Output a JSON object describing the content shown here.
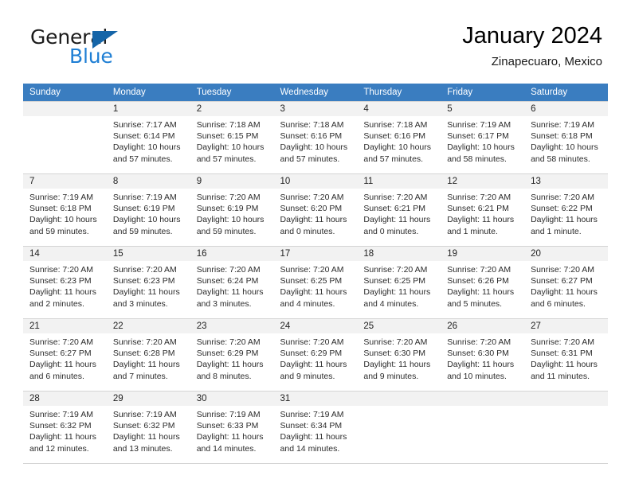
{
  "brand": {
    "name_top": "General",
    "name_bottom": "Blue",
    "triangle_color": "#1565a8",
    "blue_color": "#1f7fd4"
  },
  "header": {
    "title": "January 2024",
    "subtitle": "Zinapecuaro, Mexico",
    "header_bg": "#3a7dc0",
    "shaded_row_bg": "#f2f2f2"
  },
  "weekdays": [
    "Sunday",
    "Monday",
    "Tuesday",
    "Wednesday",
    "Thursday",
    "Friday",
    "Saturday"
  ],
  "weeks": [
    [
      {
        "day": "",
        "sunrise": "",
        "sunset": "",
        "daylight1": "",
        "daylight2": ""
      },
      {
        "day": "1",
        "sunrise": "Sunrise: 7:17 AM",
        "sunset": "Sunset: 6:14 PM",
        "daylight1": "Daylight: 10 hours",
        "daylight2": "and 57 minutes."
      },
      {
        "day": "2",
        "sunrise": "Sunrise: 7:18 AM",
        "sunset": "Sunset: 6:15 PM",
        "daylight1": "Daylight: 10 hours",
        "daylight2": "and 57 minutes."
      },
      {
        "day": "3",
        "sunrise": "Sunrise: 7:18 AM",
        "sunset": "Sunset: 6:16 PM",
        "daylight1": "Daylight: 10 hours",
        "daylight2": "and 57 minutes."
      },
      {
        "day": "4",
        "sunrise": "Sunrise: 7:18 AM",
        "sunset": "Sunset: 6:16 PM",
        "daylight1": "Daylight: 10 hours",
        "daylight2": "and 57 minutes."
      },
      {
        "day": "5",
        "sunrise": "Sunrise: 7:19 AM",
        "sunset": "Sunset: 6:17 PM",
        "daylight1": "Daylight: 10 hours",
        "daylight2": "and 58 minutes."
      },
      {
        "day": "6",
        "sunrise": "Sunrise: 7:19 AM",
        "sunset": "Sunset: 6:18 PM",
        "daylight1": "Daylight: 10 hours",
        "daylight2": "and 58 minutes."
      }
    ],
    [
      {
        "day": "7",
        "sunrise": "Sunrise: 7:19 AM",
        "sunset": "Sunset: 6:18 PM",
        "daylight1": "Daylight: 10 hours",
        "daylight2": "and 59 minutes."
      },
      {
        "day": "8",
        "sunrise": "Sunrise: 7:19 AM",
        "sunset": "Sunset: 6:19 PM",
        "daylight1": "Daylight: 10 hours",
        "daylight2": "and 59 minutes."
      },
      {
        "day": "9",
        "sunrise": "Sunrise: 7:20 AM",
        "sunset": "Sunset: 6:19 PM",
        "daylight1": "Daylight: 10 hours",
        "daylight2": "and 59 minutes."
      },
      {
        "day": "10",
        "sunrise": "Sunrise: 7:20 AM",
        "sunset": "Sunset: 6:20 PM",
        "daylight1": "Daylight: 11 hours",
        "daylight2": "and 0 minutes."
      },
      {
        "day": "11",
        "sunrise": "Sunrise: 7:20 AM",
        "sunset": "Sunset: 6:21 PM",
        "daylight1": "Daylight: 11 hours",
        "daylight2": "and 0 minutes."
      },
      {
        "day": "12",
        "sunrise": "Sunrise: 7:20 AM",
        "sunset": "Sunset: 6:21 PM",
        "daylight1": "Daylight: 11 hours",
        "daylight2": "and 1 minute."
      },
      {
        "day": "13",
        "sunrise": "Sunrise: 7:20 AM",
        "sunset": "Sunset: 6:22 PM",
        "daylight1": "Daylight: 11 hours",
        "daylight2": "and 1 minute."
      }
    ],
    [
      {
        "day": "14",
        "sunrise": "Sunrise: 7:20 AM",
        "sunset": "Sunset: 6:23 PM",
        "daylight1": "Daylight: 11 hours",
        "daylight2": "and 2 minutes."
      },
      {
        "day": "15",
        "sunrise": "Sunrise: 7:20 AM",
        "sunset": "Sunset: 6:23 PM",
        "daylight1": "Daylight: 11 hours",
        "daylight2": "and 3 minutes."
      },
      {
        "day": "16",
        "sunrise": "Sunrise: 7:20 AM",
        "sunset": "Sunset: 6:24 PM",
        "daylight1": "Daylight: 11 hours",
        "daylight2": "and 3 minutes."
      },
      {
        "day": "17",
        "sunrise": "Sunrise: 7:20 AM",
        "sunset": "Sunset: 6:25 PM",
        "daylight1": "Daylight: 11 hours",
        "daylight2": "and 4 minutes."
      },
      {
        "day": "18",
        "sunrise": "Sunrise: 7:20 AM",
        "sunset": "Sunset: 6:25 PM",
        "daylight1": "Daylight: 11 hours",
        "daylight2": "and 4 minutes."
      },
      {
        "day": "19",
        "sunrise": "Sunrise: 7:20 AM",
        "sunset": "Sunset: 6:26 PM",
        "daylight1": "Daylight: 11 hours",
        "daylight2": "and 5 minutes."
      },
      {
        "day": "20",
        "sunrise": "Sunrise: 7:20 AM",
        "sunset": "Sunset: 6:27 PM",
        "daylight1": "Daylight: 11 hours",
        "daylight2": "and 6 minutes."
      }
    ],
    [
      {
        "day": "21",
        "sunrise": "Sunrise: 7:20 AM",
        "sunset": "Sunset: 6:27 PM",
        "daylight1": "Daylight: 11 hours",
        "daylight2": "and 6 minutes."
      },
      {
        "day": "22",
        "sunrise": "Sunrise: 7:20 AM",
        "sunset": "Sunset: 6:28 PM",
        "daylight1": "Daylight: 11 hours",
        "daylight2": "and 7 minutes."
      },
      {
        "day": "23",
        "sunrise": "Sunrise: 7:20 AM",
        "sunset": "Sunset: 6:29 PM",
        "daylight1": "Daylight: 11 hours",
        "daylight2": "and 8 minutes."
      },
      {
        "day": "24",
        "sunrise": "Sunrise: 7:20 AM",
        "sunset": "Sunset: 6:29 PM",
        "daylight1": "Daylight: 11 hours",
        "daylight2": "and 9 minutes."
      },
      {
        "day": "25",
        "sunrise": "Sunrise: 7:20 AM",
        "sunset": "Sunset: 6:30 PM",
        "daylight1": "Daylight: 11 hours",
        "daylight2": "and 9 minutes."
      },
      {
        "day": "26",
        "sunrise": "Sunrise: 7:20 AM",
        "sunset": "Sunset: 6:30 PM",
        "daylight1": "Daylight: 11 hours",
        "daylight2": "and 10 minutes."
      },
      {
        "day": "27",
        "sunrise": "Sunrise: 7:20 AM",
        "sunset": "Sunset: 6:31 PM",
        "daylight1": "Daylight: 11 hours",
        "daylight2": "and 11 minutes."
      }
    ],
    [
      {
        "day": "28",
        "sunrise": "Sunrise: 7:19 AM",
        "sunset": "Sunset: 6:32 PM",
        "daylight1": "Daylight: 11 hours",
        "daylight2": "and 12 minutes."
      },
      {
        "day": "29",
        "sunrise": "Sunrise: 7:19 AM",
        "sunset": "Sunset: 6:32 PM",
        "daylight1": "Daylight: 11 hours",
        "daylight2": "and 13 minutes."
      },
      {
        "day": "30",
        "sunrise": "Sunrise: 7:19 AM",
        "sunset": "Sunset: 6:33 PM",
        "daylight1": "Daylight: 11 hours",
        "daylight2": "and 14 minutes."
      },
      {
        "day": "31",
        "sunrise": "Sunrise: 7:19 AM",
        "sunset": "Sunset: 6:34 PM",
        "daylight1": "Daylight: 11 hours",
        "daylight2": "and 14 minutes."
      },
      {
        "day": "",
        "sunrise": "",
        "sunset": "",
        "daylight1": "",
        "daylight2": ""
      },
      {
        "day": "",
        "sunrise": "",
        "sunset": "",
        "daylight1": "",
        "daylight2": ""
      },
      {
        "day": "",
        "sunrise": "",
        "sunset": "",
        "daylight1": "",
        "daylight2": ""
      }
    ]
  ]
}
